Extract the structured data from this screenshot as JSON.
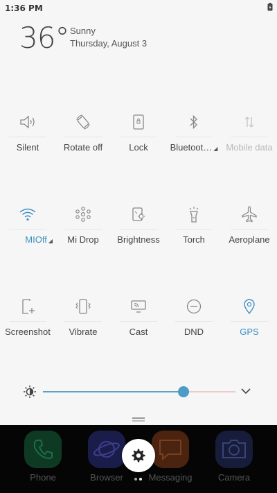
{
  "status": {
    "time": "1:36 PM"
  },
  "weather": {
    "temperature": "36°",
    "condition": "Sunny",
    "date": "Thursday, August 3"
  },
  "tiles_row1": [
    {
      "label": "Silent",
      "icon": "speaker-icon",
      "state": "off"
    },
    {
      "label": "Rotate off",
      "icon": "rotate-icon",
      "state": "off"
    },
    {
      "label": "Lock",
      "icon": "lock-screen-icon",
      "state": "off"
    },
    {
      "label": "Bluetoot…",
      "icon": "bluetooth-icon",
      "state": "off",
      "expandable": true
    },
    {
      "label": "Mobile data",
      "icon": "mobile-data-icon",
      "state": "disabled"
    }
  ],
  "tiles_row2": [
    {
      "label": "MIOff",
      "icon": "wifi-icon",
      "state": "on",
      "expandable": true
    },
    {
      "label": "Mi Drop",
      "icon": "mi-drop-icon",
      "state": "off"
    },
    {
      "label": "Brightness",
      "icon": "brightness-settings-icon",
      "state": "off"
    },
    {
      "label": "Torch",
      "icon": "torch-icon",
      "state": "off"
    },
    {
      "label": "Aeroplane",
      "icon": "airplane-icon",
      "state": "off"
    }
  ],
  "tiles_row3": [
    {
      "label": "Screenshot",
      "icon": "screenshot-icon",
      "state": "off"
    },
    {
      "label": "Vibrate",
      "icon": "vibrate-icon",
      "state": "off"
    },
    {
      "label": "Cast",
      "icon": "cast-icon",
      "state": "off"
    },
    {
      "label": "DND",
      "icon": "dnd-icon",
      "state": "off"
    },
    {
      "label": "GPS",
      "icon": "gps-icon",
      "state": "on"
    }
  ],
  "brightness": {
    "level": 0.73,
    "auto": true
  },
  "dock": [
    {
      "label": "Phone",
      "icon": "phone-icon",
      "color": "#0e3a23"
    },
    {
      "label": "Browser",
      "icon": "browser-icon",
      "color": "#1a1d4a"
    },
    {
      "label": "Messaging",
      "icon": "messaging-icon",
      "color": "#4a2410"
    },
    {
      "label": "Camera",
      "icon": "camera-icon",
      "color": "#161c3a"
    }
  ],
  "colors": {
    "accent": "#3f8fc2",
    "background": "#f6f6f6",
    "dock": "#050505"
  }
}
